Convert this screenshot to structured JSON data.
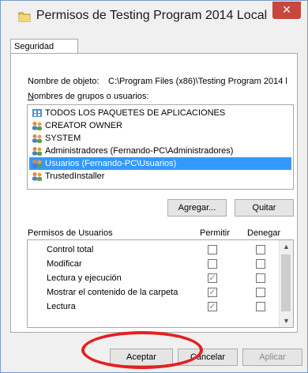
{
  "window": {
    "title": "Permisos de Testing Program 2014 Local",
    "close_glyph": "✕"
  },
  "tab": {
    "label": "Seguridad"
  },
  "object": {
    "label": "Nombre de objeto:",
    "value": "C:\\Program Files (x86)\\Testing Program 2014 l"
  },
  "groups": {
    "label": "Nombres de grupos o usuarios:",
    "items": [
      {
        "label": "TODOS LOS PAQUETES DE APLICACIONES",
        "icon": "app-packages-icon",
        "selected": false
      },
      {
        "label": "CREATOR OWNER",
        "icon": "users-group-icon",
        "selected": false
      },
      {
        "label": "SYSTEM",
        "icon": "users-group-icon",
        "selected": false
      },
      {
        "label": "Administradores (Fernando-PC\\Administradores)",
        "icon": "users-group-icon",
        "selected": false
      },
      {
        "label": "Usuarios (Fernando-PC\\Usuarios)",
        "icon": "users-group-icon",
        "selected": true
      },
      {
        "label": "TrustedInstaller",
        "icon": "users-group-icon",
        "selected": false
      }
    ]
  },
  "buttons": {
    "add": "Agregar...",
    "remove": "Quitar",
    "ok": "Aceptar",
    "cancel": "Cancelar",
    "apply": "Aplicar"
  },
  "permissions": {
    "header": "Permisos de Usuarios",
    "allow_col": "Permitir",
    "deny_col": "Denegar",
    "rows": [
      {
        "name": "Control total",
        "allow": false,
        "deny": false
      },
      {
        "name": "Modificar",
        "allow": false,
        "deny": false
      },
      {
        "name": "Lectura y ejecución",
        "allow": true,
        "deny": false
      },
      {
        "name": "Mostrar el contenido de la carpeta",
        "allow": true,
        "deny": false
      },
      {
        "name": "Lectura",
        "allow": true,
        "deny": false
      }
    ]
  },
  "colors": {
    "selection": "#3399ff",
    "close": "#c7463e",
    "highlight_oval": "#e52020"
  }
}
